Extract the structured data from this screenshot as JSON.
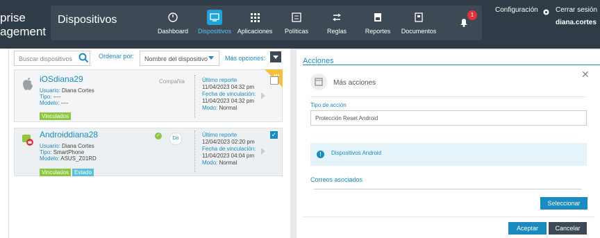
{
  "brand": {
    "line1": "prise",
    "line2": "agement"
  },
  "header": {
    "section_title": "Dispositivos",
    "notification_count": "1",
    "config_label": "Configuración",
    "logout_label": "Cerrar sesión",
    "username": "diana.cortes"
  },
  "nav": [
    {
      "label": "Dashboard",
      "icon": "dashboard-icon"
    },
    {
      "label": "Dispositivos",
      "icon": "devices-icon",
      "active": true
    },
    {
      "label": "Aplicaciones",
      "icon": "apps-grid-icon"
    },
    {
      "label": "Políticas",
      "icon": "policies-icon"
    },
    {
      "label": "Reglas",
      "icon": "rules-icon"
    },
    {
      "label": "Reportes",
      "icon": "reports-icon"
    },
    {
      "label": "Documentos",
      "icon": "documents-icon"
    }
  ],
  "toolbar": {
    "search_placeholder": "Buscar dispositivos",
    "order_label": "Ordenar por:",
    "order_value": "Nombre del dispositivo",
    "more_options_label": "Más opciones:"
  },
  "devices": [
    {
      "name": "iOSdiana29",
      "user_label": "Usuario:",
      "user": "Diana Cortes",
      "type_label": "Tipo:",
      "type": "----",
      "model_label": "Modelo:",
      "model": "----",
      "tag1": "Vinculados",
      "company": "Compañía",
      "report_label": "Último reporte",
      "report_date": "11/04/2023 04:32 pm",
      "link_label": "Fecha de vinculación:",
      "link_date": "11/04/2023 04:32 pm",
      "mode_label": "Modo:",
      "mode": "Normal"
    },
    {
      "name": "Androiddiana28",
      "user_label": "Usuario:",
      "user": "Diana Cortes",
      "type_label": "Tipo:",
      "type": "SmartPhone",
      "model_label": "Modelo:",
      "model": "ASUS_Z01RD",
      "tag1": "Vinculados",
      "tag2": "Estado",
      "do_badge": "Do",
      "report_label": "Último reporte",
      "report_date": "12/04/2023 02:20 pm",
      "link_label": "Fecha de vinculación:",
      "link_date": "11/04/2023 04:04 pm",
      "mode_label": "Modo:",
      "mode": "Normal"
    }
  ],
  "actions": {
    "title": "Acciones",
    "more_actions": "Más acciones",
    "tipo_label": "Tipo de acción",
    "tipo_value": "Protección Reset Android",
    "info_text": "Dispositivos Android",
    "correos_label": "Correos asociados",
    "select_btn": "Seleccionar",
    "accept_btn": "Aceptar",
    "cancel_btn": "Cancelar"
  },
  "colors": {
    "accent": "#1a8bc0",
    "topbar": "#2f3b46",
    "tag_green": "#8dc63f"
  }
}
